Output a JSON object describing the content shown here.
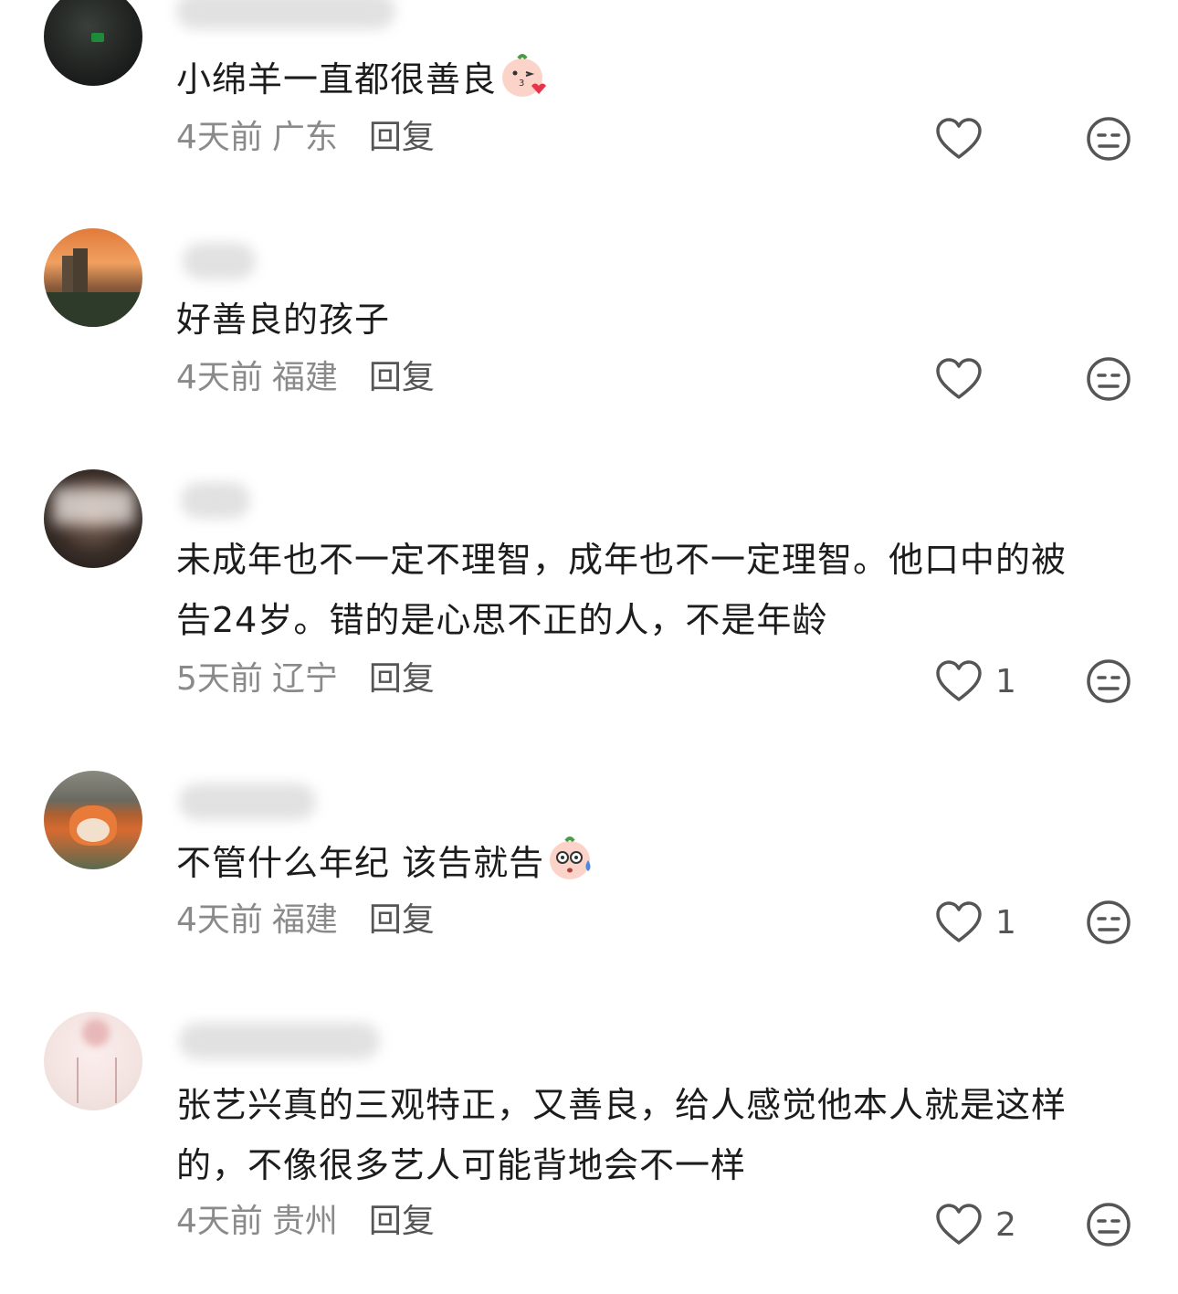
{
  "comments": [
    {
      "text": "小绵羊一直都很善良",
      "emoji": "kiss-face-icon",
      "time": "4天前",
      "location": "广东",
      "reply_label": "回复",
      "likes": ""
    },
    {
      "text": "好善良的孩子",
      "emoji": "",
      "time": "4天前",
      "location": "福建",
      "reply_label": "回复",
      "likes": ""
    },
    {
      "text_line1": "未成年也不一定不理智，成年也不一定理智。他口中的被",
      "text_line2": "告24岁。错的是心思不正的人，不是年龄",
      "time": "5天前",
      "location": "辽宁",
      "reply_label": "回复",
      "likes": "1"
    },
    {
      "text": "不管什么年纪 该告就告",
      "emoji": "nervous-face-icon",
      "time": "4天前",
      "location": "福建",
      "reply_label": "回复",
      "likes": "1"
    },
    {
      "text_line1": "张艺兴真的三观特正，又善良，给人感觉他本人就是这样",
      "text_line2": "的，不像很多艺人可能背地会不一样",
      "time": "4天前",
      "location": "贵州",
      "reply_label": "回复",
      "likes": "2"
    }
  ],
  "colors": {
    "text": "#1c1c1c",
    "meta": "#8a8a8a",
    "icon": "#555555"
  }
}
